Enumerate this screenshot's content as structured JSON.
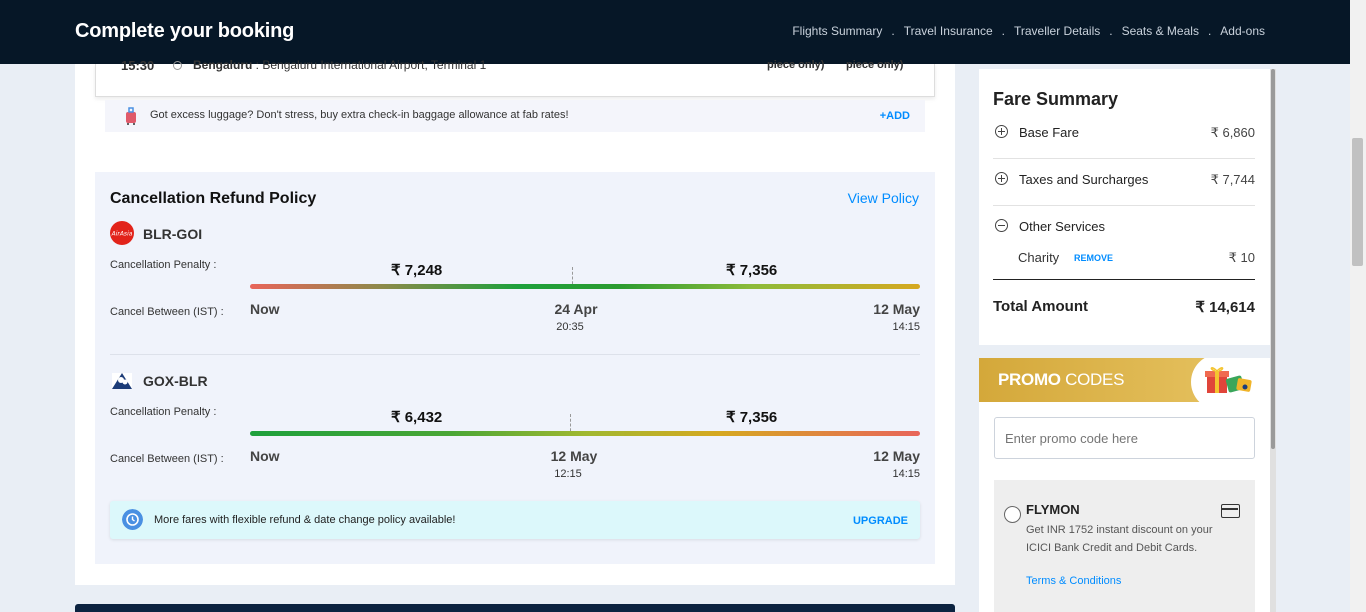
{
  "header": {
    "title": "Complete your booking",
    "nav": [
      "Flights Summary",
      "Travel Insurance",
      "Traveller Details",
      "Seats & Meals",
      "Add-ons"
    ],
    "separator": "."
  },
  "flight_remnant": {
    "time": "15:30",
    "city": "Bengaluru",
    "airport": " : Bengaluru International Airport, Terminal 1",
    "piece1": "piece only)",
    "piece2": "piece only)"
  },
  "luggage": {
    "text": "Got excess luggage? Don't stress, buy extra check-in baggage allowance at fab rates!",
    "add_label": "+ADD"
  },
  "policy": {
    "title": "Cancellation Refund Policy",
    "view_label": "View Policy",
    "penalty_label": "Cancellation Penalty :",
    "between_label": "Cancel Between (IST) :",
    "routes": [
      {
        "name": "BLR-GOI",
        "price1": "₹ 7,248",
        "price2": "₹ 7,356",
        "start": "Now",
        "mid_date": "24 Apr",
        "mid_time": "20:35",
        "end_date": "12 May",
        "end_time": "14:15"
      },
      {
        "name": "GOX-BLR",
        "price1": "₹ 6,432",
        "price2": "₹ 7,356",
        "start": "Now",
        "mid_date": "12 May",
        "mid_time": "12:15",
        "end_date": "12 May",
        "end_time": "14:15"
      }
    ],
    "upgrade_text": "More fares with flexible refund & date change policy available!",
    "upgrade_label": "UPGRADE"
  },
  "fare_summary": {
    "title": "Fare Summary",
    "rows": [
      {
        "label": "Base Fare",
        "value": "₹ 6,860"
      },
      {
        "label": "Taxes and Surcharges",
        "value": "₹ 7,744"
      },
      {
        "label": "Other Services",
        "value": ""
      }
    ],
    "charity_label": "Charity",
    "charity_remove": "REMOVE",
    "charity_value": "₹ 10",
    "total_label": "Total Amount",
    "total_value": "₹ 14,614"
  },
  "promo": {
    "title_bold": "PROMO",
    "title_light": " CODES",
    "placeholder": "Enter promo code here",
    "code": "FLYMON",
    "description": "Get INR 1752 instant discount on your ICICI Bank Credit and Debit Cards.",
    "terms": "Terms & Conditions"
  },
  "colors": {
    "header_bg": "#061727",
    "link": "#008cff",
    "promo_gold": "#d4a83a"
  }
}
